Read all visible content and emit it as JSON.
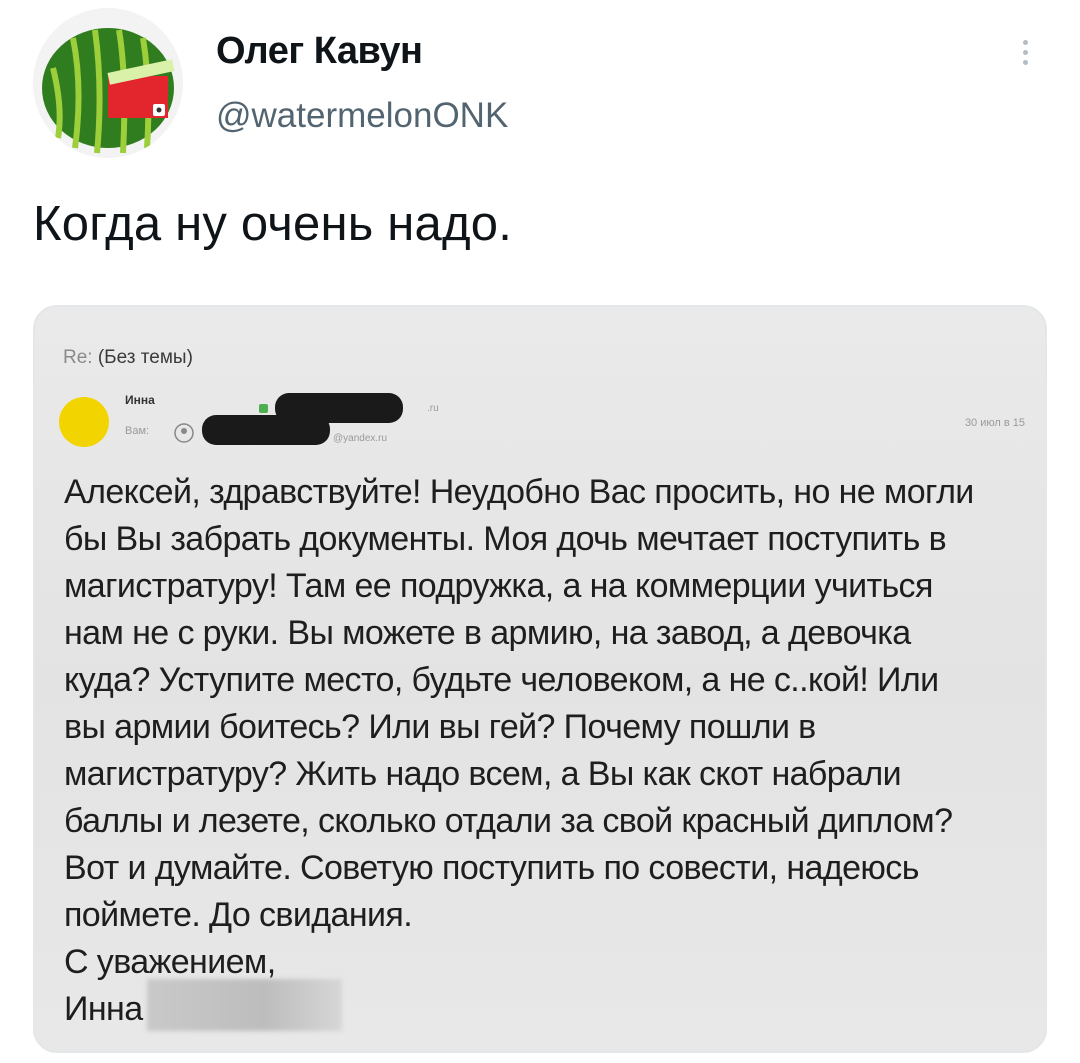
{
  "tweet": {
    "author_name": "Олег Кавун",
    "author_handle": "@watermelonONK",
    "text": "Когда ну очень надо.",
    "avatar_icon": "watermelon-avatar-icon",
    "more_icon": "more-options-icon"
  },
  "email": {
    "subject_prefix": "Re:",
    "subject": "(Без темы)",
    "sender_name": "Инна",
    "recipient_label": "Вам:",
    "domain_ru": ".ru",
    "domain_yandex": "@yandex.ru",
    "date": "30 июл в 15",
    "body_lines": [
      "Алексей, здравствуйте! Неудобно Вас просить, но не могли",
      "бы Вы забрать документы. Моя дочь мечтает поступить в",
      "магистратуру! Там ее подружка, а на коммерции учиться",
      "нам не с руки. Вы можете в армию, на завод, а девочка",
      "куда? Уступите место, будьте человеком, а не с..кой! Или",
      "вы армии боитесь? Или вы гей? Почему пошли в",
      "магистратуру? Жить надо всем, а Вы как скот набрали",
      "баллы и лезете, сколько отдали за свой красный диплом?",
      "Вот и думайте. Советую поступить по совести, надеюсь",
      "поймете. До свидания.",
      "С уважением,",
      "Инна"
    ],
    "colors": {
      "sender_dot": "#f2d400",
      "redaction": "#1a1a1a"
    }
  }
}
